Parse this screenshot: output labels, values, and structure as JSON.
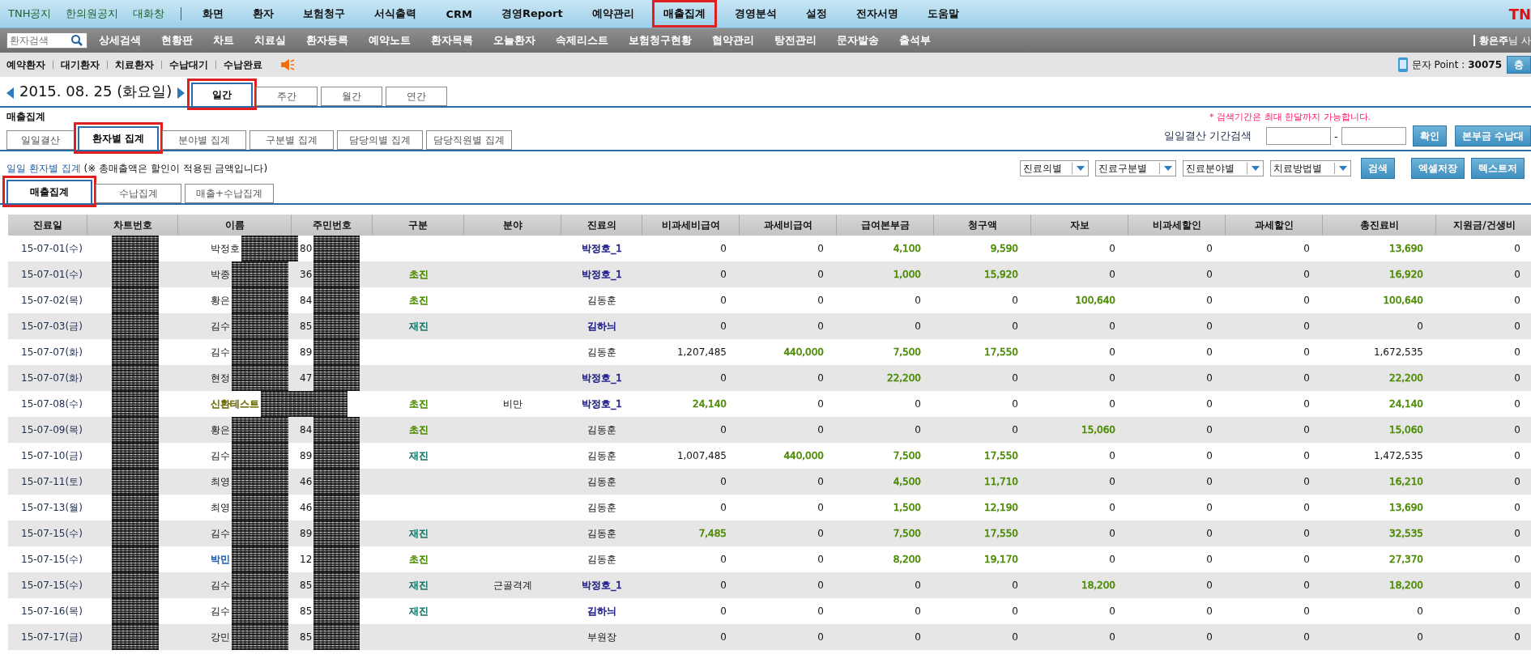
{
  "top_menu": {
    "links": [
      "TNH공지",
      "한의원공지",
      "대화창"
    ],
    "items": [
      {
        "label": "화면",
        "selected": false,
        "highlighted": false
      },
      {
        "label": "환자",
        "selected": false,
        "highlighted": false
      },
      {
        "label": "보험청구",
        "selected": false,
        "highlighted": false
      },
      {
        "label": "서식출력",
        "selected": false,
        "highlighted": false
      },
      {
        "label": "CRM",
        "selected": false,
        "highlighted": false
      },
      {
        "label": "경영Report",
        "selected": false,
        "highlighted": false
      },
      {
        "label": "예약관리",
        "selected": false,
        "highlighted": false
      },
      {
        "label": "매출집계",
        "selected": true,
        "highlighted": true
      },
      {
        "label": "경영분석",
        "selected": false,
        "highlighted": false
      },
      {
        "label": "설정",
        "selected": false,
        "highlighted": false
      },
      {
        "label": "전자서명",
        "selected": false,
        "highlighted": false
      },
      {
        "label": "도움말",
        "selected": false,
        "highlighted": false
      }
    ],
    "logo": "TN"
  },
  "sub_menu": {
    "search_placeholder": "환자검색",
    "items": [
      "상세검색",
      "현황판",
      "차트",
      "치료실",
      "환자등록",
      "예약노트",
      "환자목록",
      "오늘환자",
      "속제리스트",
      "보험청구현황",
      "협약관리",
      "탕전관리",
      "문자발송",
      "출석부"
    ],
    "user_name": "황은주",
    "user_suffix": "님 사"
  },
  "status_bar": {
    "links": [
      "예약환자",
      "대기환자",
      "치료환자",
      "수납대기",
      "수납완료"
    ],
    "sms_label": "문자 Point :",
    "sms_points": "30075",
    "sms_button": "충"
  },
  "date": {
    "text": "2015. 08. 25 (화요일)",
    "tabs": [
      {
        "label": "일간",
        "selected": true,
        "highlighted": true
      },
      {
        "label": "주간",
        "selected": false,
        "highlighted": false
      },
      {
        "label": "월간",
        "selected": false,
        "highlighted": false
      },
      {
        "label": "연간",
        "selected": false,
        "highlighted": false
      }
    ]
  },
  "section_title": "매출집계",
  "notice": "* 검색기간은 최대 한달까지 가능합니다.",
  "report_tabs": [
    {
      "label": "일일결산",
      "selected": false,
      "highlighted": false
    },
    {
      "label": "환자별 집계",
      "selected": true,
      "highlighted": true
    },
    {
      "label": "분야별 집계",
      "selected": false,
      "highlighted": false
    },
    {
      "label": "구분별 집계",
      "selected": false,
      "highlighted": false
    },
    {
      "label": "담당의별 집계",
      "selected": false,
      "highlighted": false
    },
    {
      "label": "담당직원별 집계",
      "selected": false,
      "highlighted": false
    }
  ],
  "period_search": {
    "label": "일일결산 기간검색",
    "separator": "-",
    "confirm": "확인",
    "extra_button": "본부금 수납대"
  },
  "summary": {
    "title": "일일 환자별 집계",
    "note": "(※ 총매출액은 할인이 적용된 금액입니다)"
  },
  "filters": [
    "진료의별",
    "진료구분별",
    "진료분야별",
    "치료방법별"
  ],
  "action_buttons": [
    "검색",
    "엑셀저장",
    "텍스트저"
  ],
  "sub_tabs": [
    {
      "label": "매출집계",
      "selected": true,
      "highlighted": true
    },
    {
      "label": "수납집계",
      "selected": false,
      "highlighted": false
    },
    {
      "label": "매출+수납집계",
      "selected": false,
      "highlighted": false
    }
  ],
  "table": {
    "columns": [
      "진료일",
      "차트번호",
      "이름",
      "주민번호",
      "구분",
      "분야",
      "진료의",
      "비과세비급여",
      "과세비급여",
      "급여본부금",
      "청구액",
      "자보",
      "비과세할인",
      "과세할인",
      "총진료비",
      "지원금/건생비"
    ],
    "rows": [
      {
        "cells": [
          "15-07-01(수)",
          {
            "redacted": true
          },
          {
            "text": "박정호",
            "redacted": true
          },
          {
            "text": "80",
            "redacted": true
          },
          "",
          "",
          {
            "text": "박정호_1",
            "color": "#22228a"
          },
          "0",
          "0",
          {
            "text": "4,100",
            "color": "#4a8a00"
          },
          {
            "text": "9,590",
            "color": "#4a8a00"
          },
          "0",
          "0",
          "0",
          {
            "text": "13,690",
            "color": "#4a8a00"
          },
          "0"
        ]
      },
      {
        "cells": [
          "15-07-01(수)",
          {
            "redacted": true
          },
          {
            "text": "박종",
            "redacted": true
          },
          {
            "text": "36",
            "redacted": true
          },
          {
            "text": "초진",
            "color": "#4a8a00"
          },
          "",
          {
            "text": "박정호_1",
            "color": "#22228a"
          },
          "0",
          "0",
          {
            "text": "1,000",
            "color": "#4a8a00"
          },
          {
            "text": "15,920",
            "color": "#4a8a00"
          },
          "0",
          "0",
          "0",
          {
            "text": "16,920",
            "color": "#4a8a00"
          },
          "0"
        ]
      },
      {
        "cells": [
          "15-07-02(목)",
          {
            "redacted": true
          },
          {
            "text": "황은",
            "redacted": true
          },
          {
            "text": "84",
            "redacted": true
          },
          {
            "text": "초진",
            "color": "#4a8a00"
          },
          "",
          "김동훈",
          "0",
          "0",
          "0",
          "0",
          {
            "text": "100,640",
            "color": "#4a8a00"
          },
          "0",
          "0",
          {
            "text": "100,640",
            "color": "#4a8a00"
          },
          "0"
        ]
      },
      {
        "cells": [
          "15-07-03(금)",
          {
            "redacted": true
          },
          {
            "text": "김수",
            "redacted": true
          },
          {
            "text": "85",
            "redacted": true
          },
          {
            "text": "재진",
            "color": "#1a7a6a"
          },
          "",
          {
            "text": "김하늬",
            "color": "#22228a"
          },
          "0",
          "0",
          "0",
          "0",
          "0",
          "0",
          "0",
          "0",
          "0"
        ]
      },
      {
        "cells": [
          "15-07-07(화)",
          {
            "redacted": true
          },
          {
            "text": "김수",
            "redacted": true
          },
          {
            "text": "89",
            "redacted": true
          },
          "",
          "",
          "김동훈",
          "1,207,485",
          {
            "text": "440,000",
            "color": "#4a8a00"
          },
          {
            "text": "7,500",
            "color": "#4a8a00"
          },
          {
            "text": "17,550",
            "color": "#4a8a00"
          },
          "0",
          "0",
          "0",
          "1,672,535",
          "0"
        ]
      },
      {
        "cells": [
          "15-07-07(화)",
          {
            "redacted": true
          },
          {
            "text": "현정",
            "redacted": true
          },
          {
            "text": "47",
            "redacted": true
          },
          "",
          "",
          {
            "text": "박정호_1",
            "color": "#22228a"
          },
          "0",
          "0",
          {
            "text": "22,200",
            "color": "#4a8a00"
          },
          "0",
          "0",
          "0",
          "0",
          {
            "text": "22,200",
            "color": "#4a8a00"
          },
          "0"
        ]
      },
      {
        "cells": [
          "15-07-08(수)",
          {
            "redacted": true
          },
          {
            "text": "신환테스트",
            "color": "#6b6b00",
            "redacted": true
          },
          {
            "redacted": true
          },
          {
            "text": "초진",
            "color": "#4a8a00"
          },
          "비만",
          {
            "text": "박정호_1",
            "color": "#22228a"
          },
          {
            "text": "24,140",
            "color": "#4a8a00"
          },
          "0",
          "0",
          "0",
          "0",
          "0",
          "0",
          {
            "text": "24,140",
            "color": "#4a8a00"
          },
          "0"
        ]
      },
      {
        "cells": [
          "15-07-09(목)",
          {
            "redacted": true
          },
          {
            "text": "황은",
            "redacted": true
          },
          {
            "text": "84",
            "redacted": true
          },
          {
            "text": "초진",
            "color": "#4a8a00"
          },
          "",
          "김동훈",
          "0",
          "0",
          "0",
          "0",
          {
            "text": "15,060",
            "color": "#4a8a00"
          },
          "0",
          "0",
          {
            "text": "15,060",
            "color": "#4a8a00"
          },
          "0"
        ]
      },
      {
        "cells": [
          "15-07-10(금)",
          {
            "redacted": true
          },
          {
            "text": "김수",
            "redacted": true
          },
          {
            "text": "89",
            "redacted": true
          },
          {
            "text": "재진",
            "color": "#1a7a6a"
          },
          "",
          "김동훈",
          "1,007,485",
          {
            "text": "440,000",
            "color": "#4a8a00"
          },
          {
            "text": "7,500",
            "color": "#4a8a00"
          },
          {
            "text": "17,550",
            "color": "#4a8a00"
          },
          "0",
          "0",
          "0",
          "1,472,535",
          "0"
        ]
      },
      {
        "cells": [
          "15-07-11(토)",
          {
            "redacted": true
          },
          {
            "text": "최영",
            "redacted": true
          },
          {
            "text": "46",
            "redacted": true
          },
          "",
          "",
          "김동훈",
          "0",
          "0",
          {
            "text": "4,500",
            "color": "#4a8a00"
          },
          {
            "text": "11,710",
            "color": "#4a8a00"
          },
          "0",
          "0",
          "0",
          {
            "text": "16,210",
            "color": "#4a8a00"
          },
          "0"
        ]
      },
      {
        "cells": [
          "15-07-13(월)",
          {
            "redacted": true
          },
          {
            "text": "최영",
            "redacted": true
          },
          {
            "text": "46",
            "redacted": true
          },
          "",
          "",
          "김동훈",
          "0",
          "0",
          {
            "text": "1,500",
            "color": "#4a8a00"
          },
          {
            "text": "12,190",
            "color": "#4a8a00"
          },
          "0",
          "0",
          "0",
          {
            "text": "13,690",
            "color": "#4a8a00"
          },
          "0"
        ]
      },
      {
        "cells": [
          "15-07-15(수)",
          {
            "redacted": true
          },
          {
            "text": "김수",
            "redacted": true
          },
          {
            "text": "89",
            "redacted": true
          },
          {
            "text": "재진",
            "color": "#1a7a6a"
          },
          "",
          "김동훈",
          {
            "text": "7,485",
            "color": "#4a8a00"
          },
          "0",
          {
            "text": "7,500",
            "color": "#4a8a00"
          },
          {
            "text": "17,550",
            "color": "#4a8a00"
          },
          "0",
          "0",
          "0",
          {
            "text": "32,535",
            "color": "#4a8a00"
          },
          "0"
        ]
      },
      {
        "cells": [
          "15-07-15(수)",
          {
            "redacted": true
          },
          {
            "text": "박민",
            "color": "#1f5fbf",
            "redacted": true
          },
          {
            "text": "12",
            "redacted": true
          },
          {
            "text": "초진",
            "color": "#4a8a00"
          },
          "",
          "김동훈",
          "0",
          "0",
          {
            "text": "8,200",
            "color": "#4a8a00"
          },
          {
            "text": "19,170",
            "color": "#4a8a00"
          },
          "0",
          "0",
          "0",
          {
            "text": "27,370",
            "color": "#4a8a00"
          },
          "0"
        ]
      },
      {
        "cells": [
          "15-07-15(수)",
          {
            "redacted": true
          },
          {
            "text": "김수",
            "redacted": true
          },
          {
            "text": "85",
            "redacted": true
          },
          {
            "text": "재진",
            "color": "#1a7a6a"
          },
          "근골격계",
          {
            "text": "박정호_1",
            "color": "#22228a"
          },
          "0",
          "0",
          "0",
          "0",
          {
            "text": "18,200",
            "color": "#4a8a00"
          },
          "0",
          "0",
          {
            "text": "18,200",
            "color": "#4a8a00"
          },
          "0"
        ]
      },
      {
        "cells": [
          "15-07-16(목)",
          {
            "redacted": true
          },
          {
            "text": "김수",
            "redacted": true
          },
          {
            "text": "85",
            "redacted": true
          },
          {
            "text": "재진",
            "color": "#1a7a6a"
          },
          "",
          {
            "text": "김하늬",
            "color": "#22228a"
          },
          "0",
          "0",
          "0",
          "0",
          "0",
          "0",
          "0",
          "0",
          "0"
        ]
      },
      {
        "cells": [
          "15-07-17(금)",
          {
            "redacted": true
          },
          {
            "text": "강민",
            "redacted": true
          },
          {
            "text": "85",
            "redacted": true
          },
          "",
          "",
          "부원장",
          "0",
          "0",
          "0",
          "0",
          "0",
          "0",
          "0",
          "0",
          "0"
        ]
      }
    ]
  }
}
